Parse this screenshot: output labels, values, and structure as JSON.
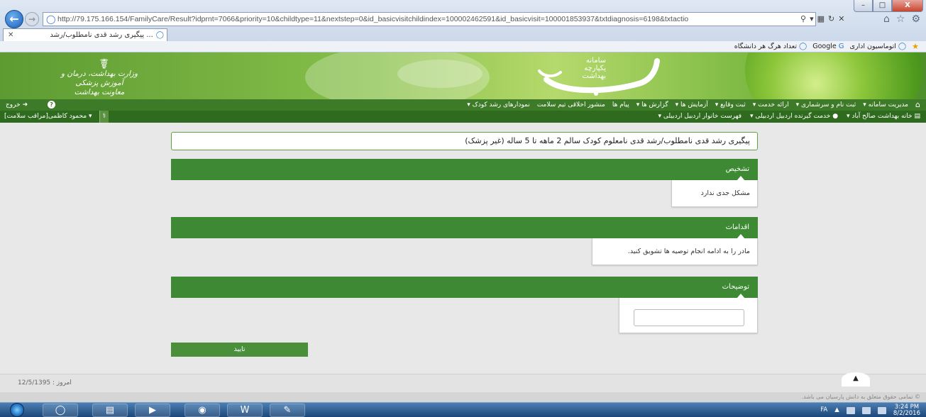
{
  "browser": {
    "url": "http://79.175.166.154/FamilyCare/Result?idprnt=7066&priority=10&childtype=11&nextstep=0&id_basicvisitchildindex=100002462591&id_basicvisit=100001853937&txtdiagnosis=6198&txtactio",
    "tab_title": "پیگیری رشد قدی نامطلوب/رشد ...",
    "favorites": [
      "اتوماسیون اداری",
      "Google",
      "تعداد هرگ هر دانشگاه"
    ],
    "window_controls": [
      "–",
      "□",
      "X"
    ]
  },
  "banner": {
    "ministry_lines": [
      "وزارت بهداشت، درمان و آموزش پزشکی",
      "معاونت بهداشت"
    ],
    "app_title_lines": [
      "سامانه",
      "یکپارچه",
      "بهداشت"
    ]
  },
  "nav1": {
    "items": [
      "مدیریت سامانه",
      "ثبت نام و سرشماری",
      "ارائه خدمت",
      "ثبت وقایع",
      "آزمایش ها",
      "گزارش ها",
      "پیام ها",
      "منشور اخلاقی تیم سلامت",
      "نمودارهای رشد کودک"
    ],
    "exit_label": "خروج"
  },
  "nav2": {
    "items": [
      "خانه بهداشت صالح آباد",
      "خدمت گیرنده اردبیل اردبیلی",
      "فهرست خانوار اردبیل اردبیلی"
    ],
    "user": "محمود کاظمی[مراقب سلامت]"
  },
  "main": {
    "heading": "پیگیری رشد قدی نامطلوب/رشد قدی نامعلوم کودک سالم 2 ماهه تا 5 ساله (غیر پزشک)",
    "panels": [
      {
        "title": "تشخیص",
        "content": "مشکل جدی ندارد"
      },
      {
        "title": "اقدامات",
        "content": "مادر را به ادامه انجام توصیه ها تشویق کنید."
      },
      {
        "title": "توضیحات"
      }
    ],
    "comment_value": "",
    "confirm_label": "تایید"
  },
  "footer": {
    "today": "امروز : 12/5/1395",
    "copyright": "© تمامی حقوق متعلق به دانش پارسیان می باشد."
  },
  "taskbar": {
    "lang": "FA",
    "time": "3:24 PM",
    "date": "8/2/2016"
  }
}
